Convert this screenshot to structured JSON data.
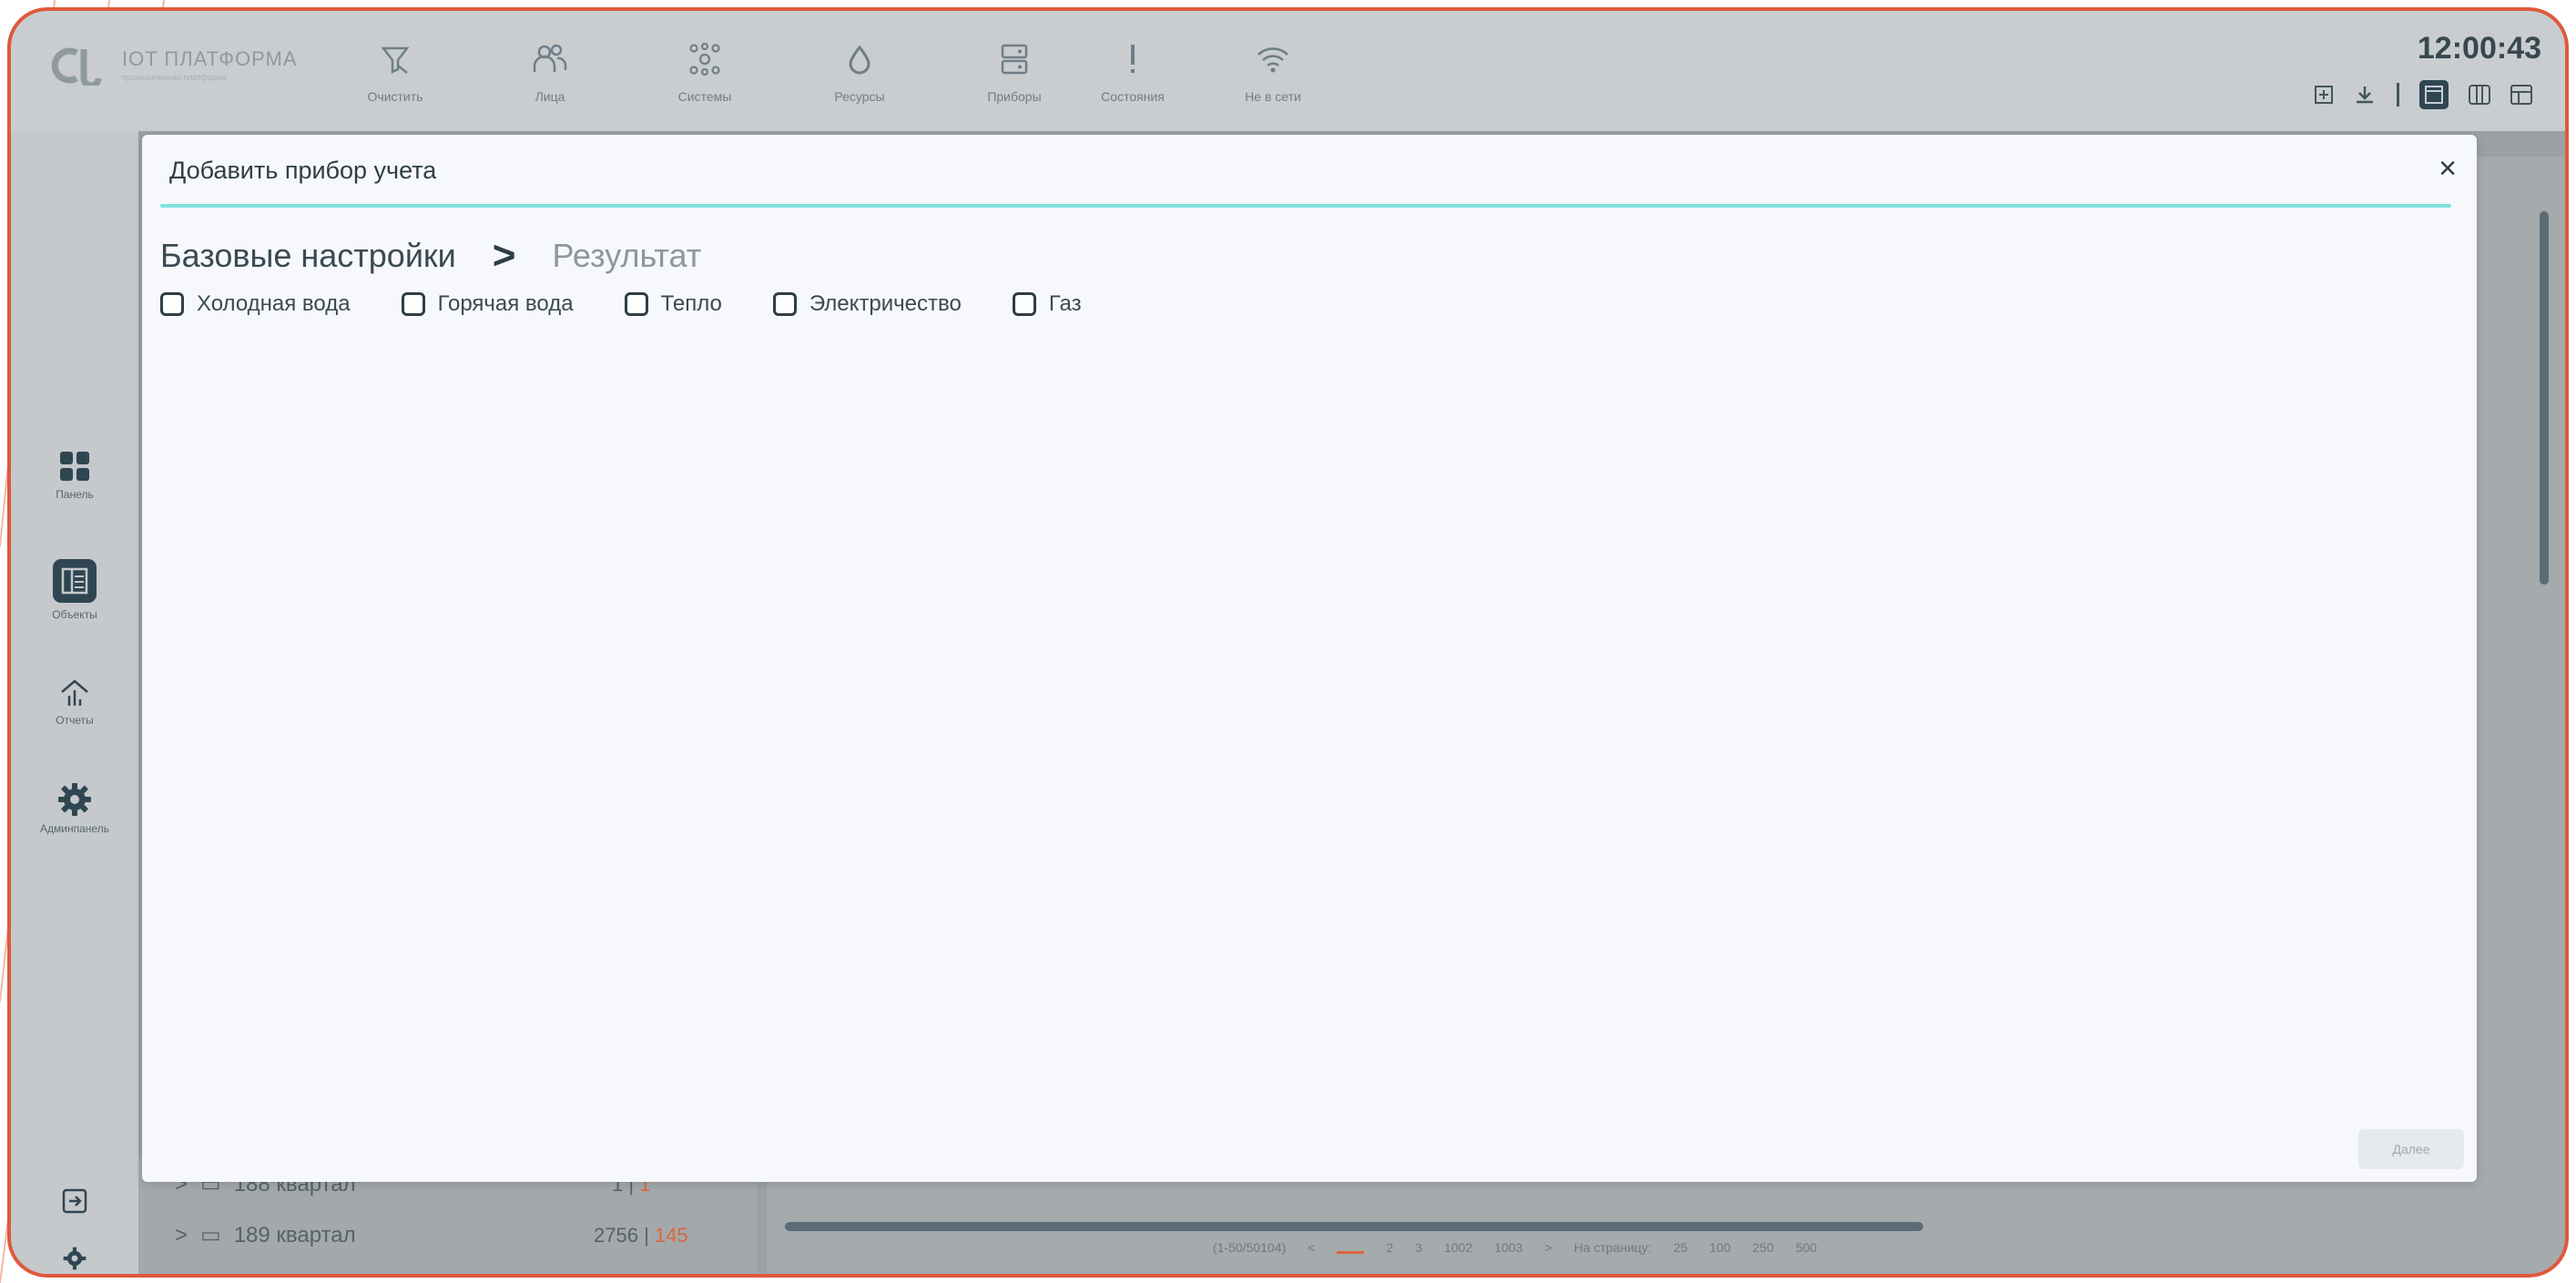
{
  "app": {
    "logo_text": "IOT ПЛАТФОРМА",
    "logo_sub": "промышленная платформа",
    "clock": "12:00:43"
  },
  "toolbar": {
    "items": [
      {
        "label": "Очистить",
        "icon": "filter-clear-icon"
      },
      {
        "label": "Лица",
        "icon": "people-icon"
      },
      {
        "label": "Системы",
        "icon": "network-icon"
      },
      {
        "label": "Ресурсы",
        "icon": "drop-icon"
      },
      {
        "label": "Приборы",
        "icon": "server-icon"
      },
      {
        "label": "Состояния",
        "icon": "exclamation-icon"
      },
      {
        "label": "Не в сети",
        "icon": "wifi-icon"
      }
    ],
    "right": [
      "add-icon",
      "download-icon",
      "layout-single-icon",
      "layout-columns-icon",
      "layout-grid-icon"
    ]
  },
  "sidebar": {
    "items": [
      {
        "label": "Панель",
        "icon": "grid-icon"
      },
      {
        "label": "Объекты",
        "icon": "objects-icon"
      },
      {
        "label": "Отчеты",
        "icon": "reports-icon"
      },
      {
        "label": "Админпанель",
        "icon": "gear-icon"
      }
    ]
  },
  "background": {
    "tree": [
      {
        "label": "188 квартал",
        "count": "1",
        "alert": "1"
      },
      {
        "label": "189 квартал",
        "count": "2756",
        "alert": "145"
      }
    ],
    "pager": {
      "range": "(1-50/50104)",
      "pages": [
        "2",
        "3",
        "1002",
        "1003"
      ],
      "per_page_label": "На страницу:",
      "per_page_options": [
        "25",
        "100",
        "250",
        "500"
      ]
    }
  },
  "modal": {
    "title": "Добавить прибор учета",
    "close": "×",
    "steps": {
      "active": "Базовые настройки",
      "separator": ">",
      "inactive": "Результат"
    },
    "checkboxes": [
      {
        "label": "Холодная вода",
        "checked": false
      },
      {
        "label": "Горячая вода",
        "checked": false
      },
      {
        "label": "Тепло",
        "checked": false
      },
      {
        "label": "Электричество",
        "checked": false
      },
      {
        "label": "Газ",
        "checked": false
      }
    ],
    "next_button": "Далее"
  },
  "colors": {
    "accent_line": "#7ee1dc",
    "frame": "#e0583c",
    "alert": "#d9683f"
  }
}
